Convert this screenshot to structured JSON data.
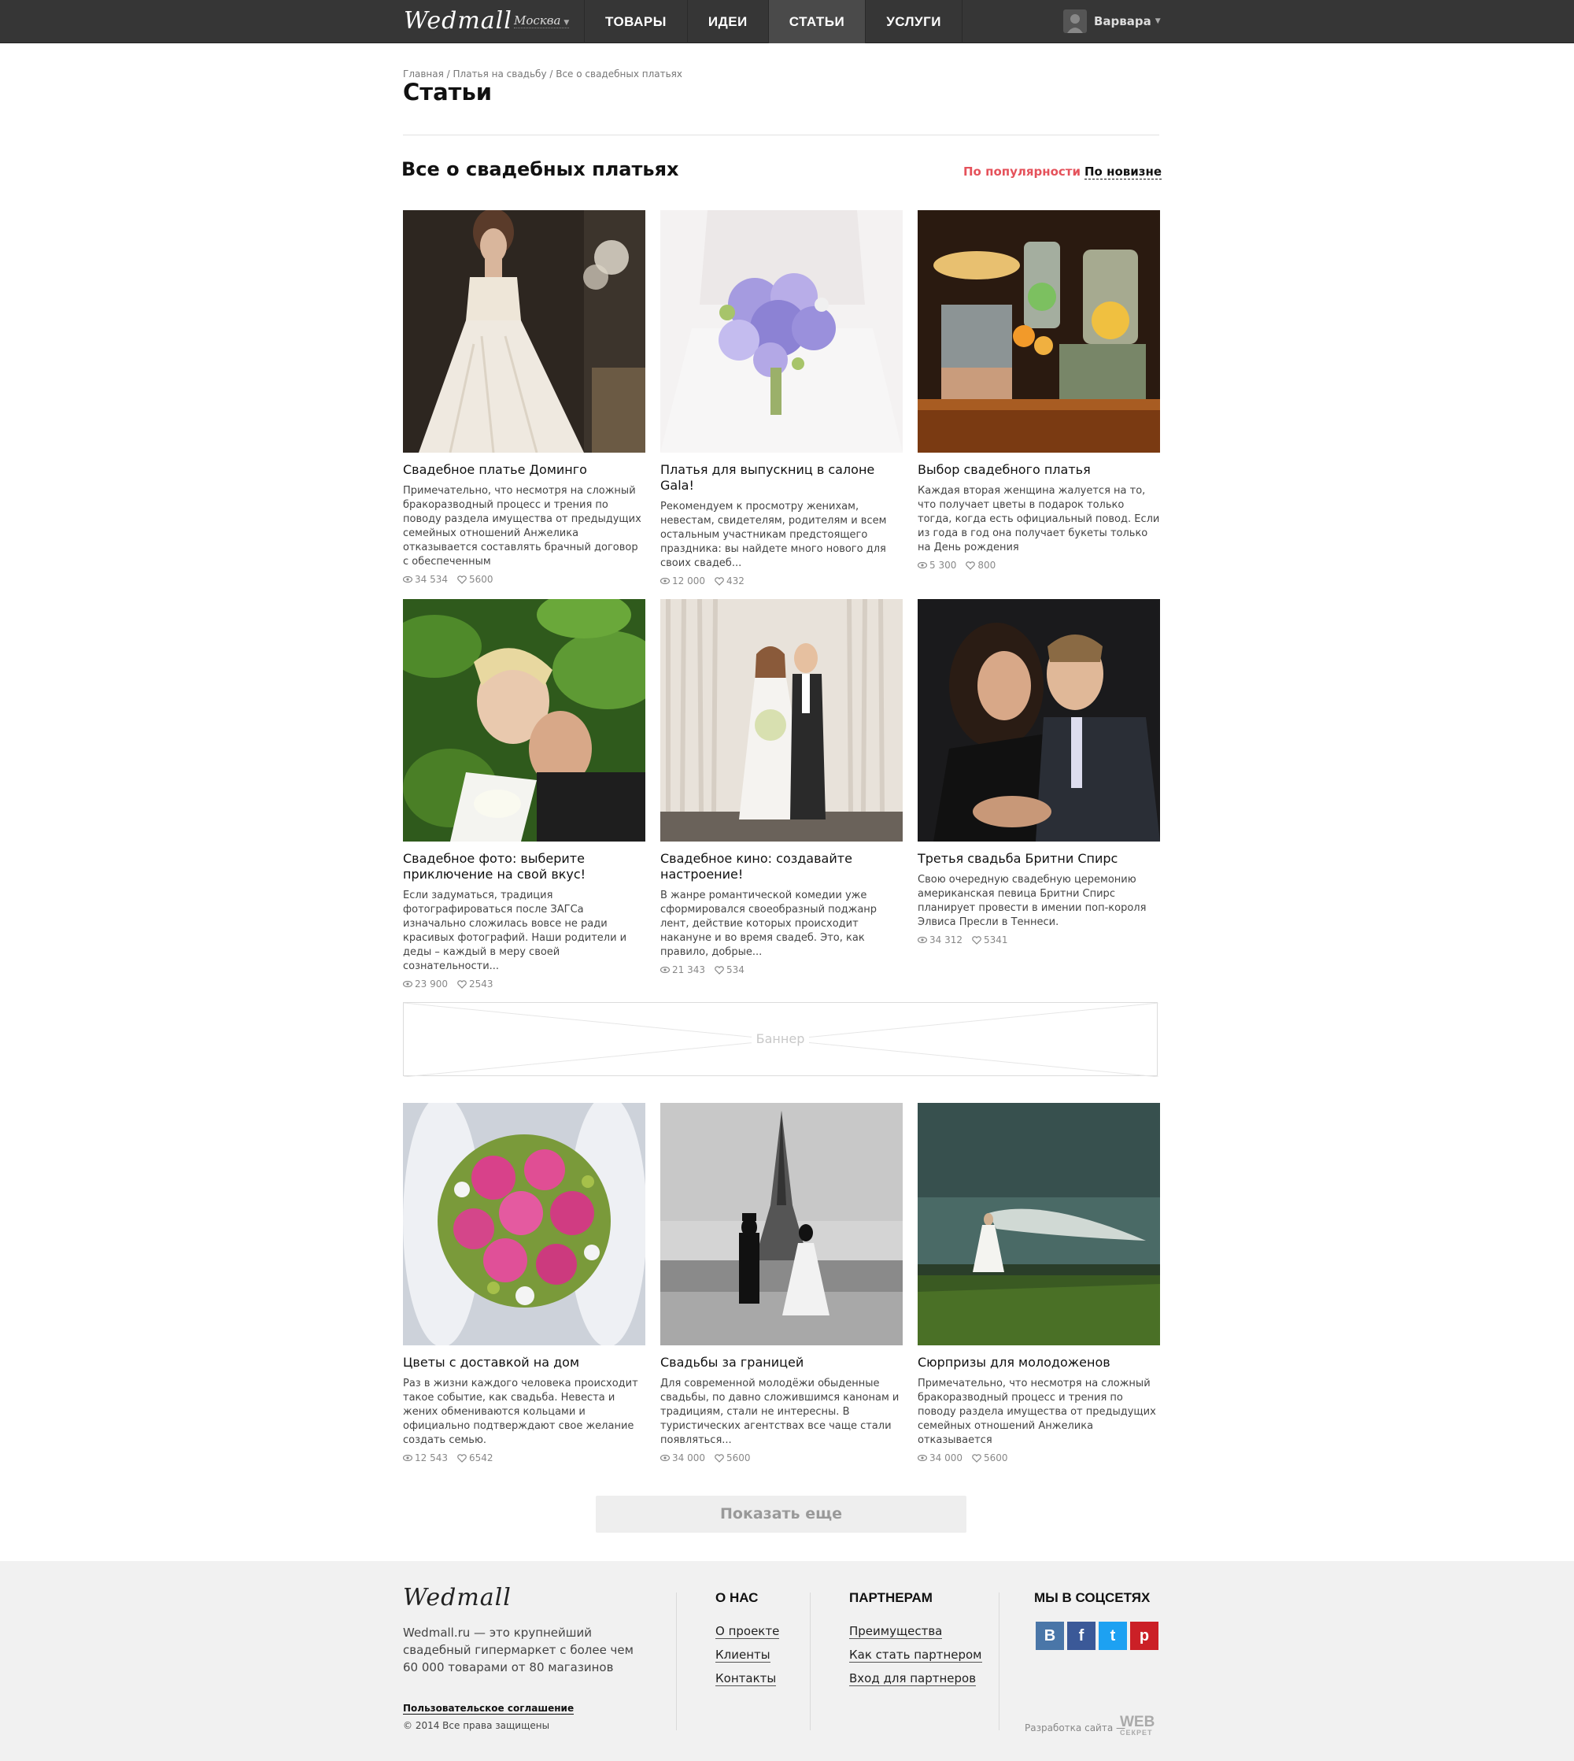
{
  "header": {
    "logo": "Wedmall",
    "city": "Москва",
    "nav": [
      "ТОВАРЫ",
      "ИДЕИ",
      "СТАТЬИ",
      "УСЛУГИ"
    ],
    "user": "Варвара"
  },
  "page": {
    "breadcrumb": "Главная / Платья на свадьбу / Все о свадебных платьях",
    "title": "Статьи",
    "section_title": "Все о свадебных платьях",
    "sort_popular": "По популярности",
    "sort_new": "По новизне"
  },
  "articles": [
    {
      "title": "Свадебное платье Доминго",
      "text": "Примечательно, что несмотря на сложный бракоразводный процесс и трения по поводу раздела имущества от предыдущих семейных отношений Анжелика отказывается составлять брачный договор с обеспеченным",
      "views": "34 534",
      "likes": "5600"
    },
    {
      "title": "Платья для выпускниц в салоне Gala!",
      "text": "Рекомендуем к просмотру женихам, невестам, свидетелям, родителям и всем остальным участникам предстоящего праздника: вы найдете много нового для своих свадеб...",
      "views": "12 000",
      "likes": "432"
    },
    {
      "title": "Выбор свадебного платья",
      "text": "Каждая вторая женщина жалуется на то, что получает цветы в подарок только тогда, когда есть официальный повод. Если из года в год она получает букеты только на День рождения",
      "views": "5 300",
      "likes": "800"
    },
    {
      "title": "Свадебное фото: выберите приключение на свой вкус!",
      "text": "Если задуматься, традиция фотографироваться после ЗАГСа изначально сложилась вовсе не ради красивых фотографий. Наши родители и деды – каждый в меру своей сознательности...",
      "views": "23 900",
      "likes": "2543"
    },
    {
      "title": "Свадебное кино: создавайте настроение!",
      "text": "В жанре романтической комедии уже сформировался своеобразный поджанр лент, действие которых происходит накануне и во время свадеб. Это, как правило, добрые...",
      "views": "21 343",
      "likes": "534"
    },
    {
      "title": "Третья свадьба Бритни Спирс",
      "text": "Свою очередную свадебную церемонию американская певица Бритни Спирс планирует провести в имении поп-короля Элвиса Пресли в Теннеси.",
      "views": "34 312",
      "likes": "5341"
    },
    {
      "title": "Цветы с доставкой на дом",
      "text": "Раз в жизни каждого человека происходит такое событие, как свадьба. Невеста и жених обмениваются кольцами и официально подтверждают свое желание создать семью.",
      "views": "12 543",
      "likes": "6542"
    },
    {
      "title": "Свадьбы за границей",
      "text": "Для современной молодёжи обыденные свадьбы, по давно сложившимся канонам и традициям, стали не интересны. В туристических агентствах все чаще стали появляться...",
      "views": "34 000",
      "likes": "5600"
    },
    {
      "title": "Сюрпризы для молодоженов",
      "text": "Примечательно, что несмотря на сложный бракоразводный процесс и трения по поводу раздела имущества от предыдущих семейных отношений Анжелика отказывается",
      "views": "34 000",
      "likes": "5600"
    }
  ],
  "banner": {
    "label": "Баннер"
  },
  "more_button": "Показать еще",
  "footer": {
    "logo": "Wedmall",
    "about": "Wedmall.ru — это крупнейший свадебный гипермаркет с более чем 60 000 товарами от 80 магазинов",
    "agreement": "Пользовательское соглашение",
    "copyright": "© 2014 Все права защищены",
    "col_about": {
      "title": "О НАС",
      "links": [
        "О проекте",
        "Клиенты",
        "Контакты"
      ]
    },
    "col_partners": {
      "title": "ПАРТНЕРАМ",
      "links": [
        "Преимущества",
        "Как стать партнером",
        "Вход для партнеров"
      ]
    },
    "social": {
      "title": "МЫ В СОЦСЕТЯХ",
      "items": [
        {
          "icon": "vk-icon",
          "glyph": "В",
          "color": "#4a76a8"
        },
        {
          "icon": "facebook-icon",
          "glyph": "f",
          "color": "#3b5998"
        },
        {
          "icon": "twitter-icon",
          "glyph": "t",
          "color": "#1da1f2"
        },
        {
          "icon": "pinterest-icon",
          "glyph": "p",
          "color": "#cb2027"
        }
      ]
    },
    "dev_label": "Разработка сайта —",
    "dev_logo": "WEB",
    "dev_logo_sub": "СЕКРЕТ"
  },
  "colors": {
    "accent": "#e5525b",
    "header_bg": "#363636",
    "footer_bg": "#f1f1f1"
  }
}
